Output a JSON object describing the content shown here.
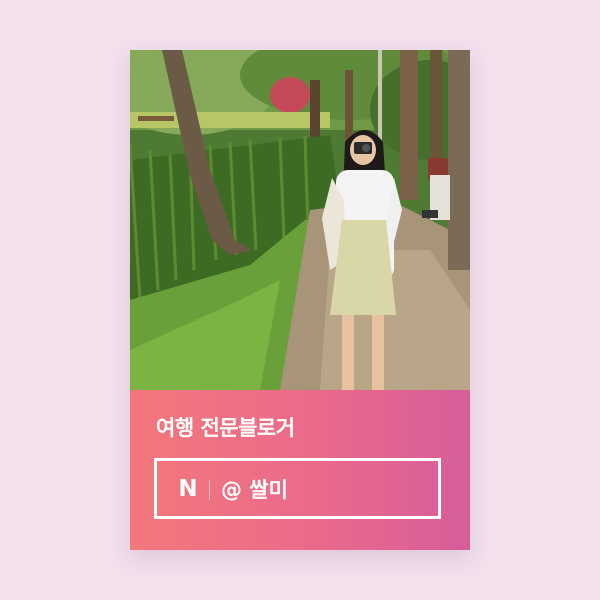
{
  "card": {
    "headline": "여행 전문블로거",
    "platform_icon_letter": "N",
    "handle": "@ 쌀미"
  },
  "colors": {
    "page_background": "#f3e1ee",
    "gradient_start": "#f3787c",
    "gradient_end": "#d65d9a",
    "text": "#ffffff"
  }
}
